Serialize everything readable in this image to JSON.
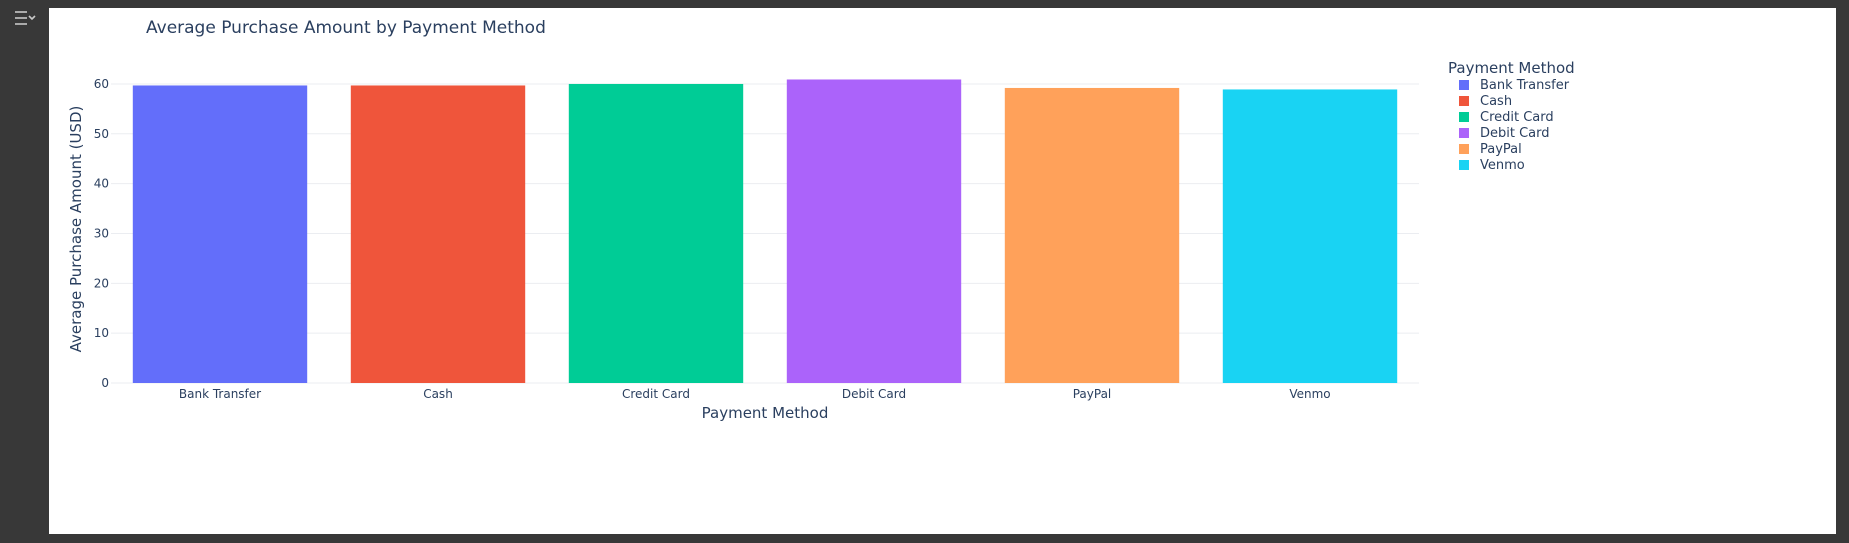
{
  "sidebar": {
    "toggle_icon": "collapse-sidebar-icon"
  },
  "colors": {
    "Bank Transfer": "#636efa",
    "Cash": "#ef553b",
    "Credit Card": "#00cc96",
    "Debit Card": "#ab63fa",
    "PayPal": "#ffa15a",
    "Venmo": "#19d3f3"
  },
  "chart_data": {
    "type": "bar",
    "title": "Average Purchase Amount by Payment Method",
    "xlabel": "Payment Method",
    "ylabel": "Average Purchase Amount (USD)",
    "ylim": [
      0,
      62
    ],
    "yticks": [
      0,
      10,
      20,
      30,
      40,
      50,
      60
    ],
    "grid": true,
    "legend_title": "Payment Method",
    "legend_position": "top-right",
    "categories": [
      "Bank Transfer",
      "Cash",
      "Credit Card",
      "Debit Card",
      "PayPal",
      "Venmo"
    ],
    "values": [
      59.7,
      59.7,
      60.0,
      60.9,
      59.2,
      58.9
    ]
  }
}
